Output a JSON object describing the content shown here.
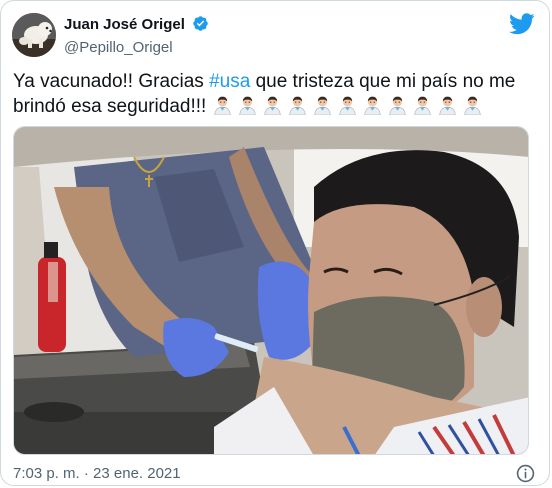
{
  "author": {
    "display_name": "Juan José Origel",
    "handle": "@Pepillo_Origel",
    "verified_icon": "verified-badge-icon",
    "avatar_icon": "avatar-photo"
  },
  "tweet": {
    "text_before": "Ya vacunado!! Gracias ",
    "hashtag": "#usa",
    "text_after": " que tristeza que mi país no me brindó esa seguridad!!! ",
    "emoji_name": "man-health-worker-emoji",
    "emoji_count": 11
  },
  "media": {
    "icon": "photo-vaccination-in-car"
  },
  "footer": {
    "timestamp": "7:03 p. m. · 23 ene. 2021",
    "info_icon": "info-icon"
  },
  "colors": {
    "brand": "#1d9bf0",
    "text": "#0f1419",
    "secondary": "#536471",
    "border": "#cfd9de"
  }
}
